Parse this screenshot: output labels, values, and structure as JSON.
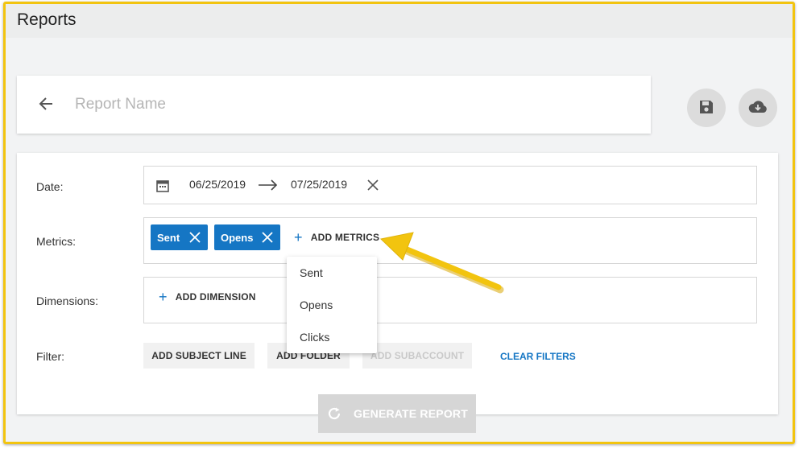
{
  "page": {
    "title": "Reports"
  },
  "report_name": {
    "placeholder": "Report Name",
    "value": ""
  },
  "icons": {
    "back": "arrow-left-icon",
    "save": "floppy-disk-icon",
    "download": "cloud-download-icon",
    "calendar": "calendar-icon",
    "clear": "close-icon",
    "refresh": "refresh-icon"
  },
  "form": {
    "date": {
      "label": "Date:",
      "start": "06/25/2019",
      "end": "07/25/2019"
    },
    "metrics": {
      "label": "Metrics:",
      "chips": [
        "Sent",
        "Opens"
      ],
      "add_label": "ADD METRICS"
    },
    "dimensions": {
      "label": "Dimensions:",
      "add_label": "ADD DIMENSION"
    },
    "filter": {
      "label": "Filter:",
      "buttons": [
        "ADD SUBJECT LINE",
        "ADD FOLDER",
        "ADD SUBACCOUNT"
      ],
      "clear_label": "CLEAR FILTERS"
    }
  },
  "metrics_dropdown": {
    "items": [
      "Sent",
      "Opens",
      "Clicks"
    ]
  },
  "generate_button": {
    "label": "GENERATE REPORT"
  },
  "colors": {
    "accent": "#1576c4",
    "highlight": "#f2c40f",
    "disabled": "#d6d6d6"
  }
}
